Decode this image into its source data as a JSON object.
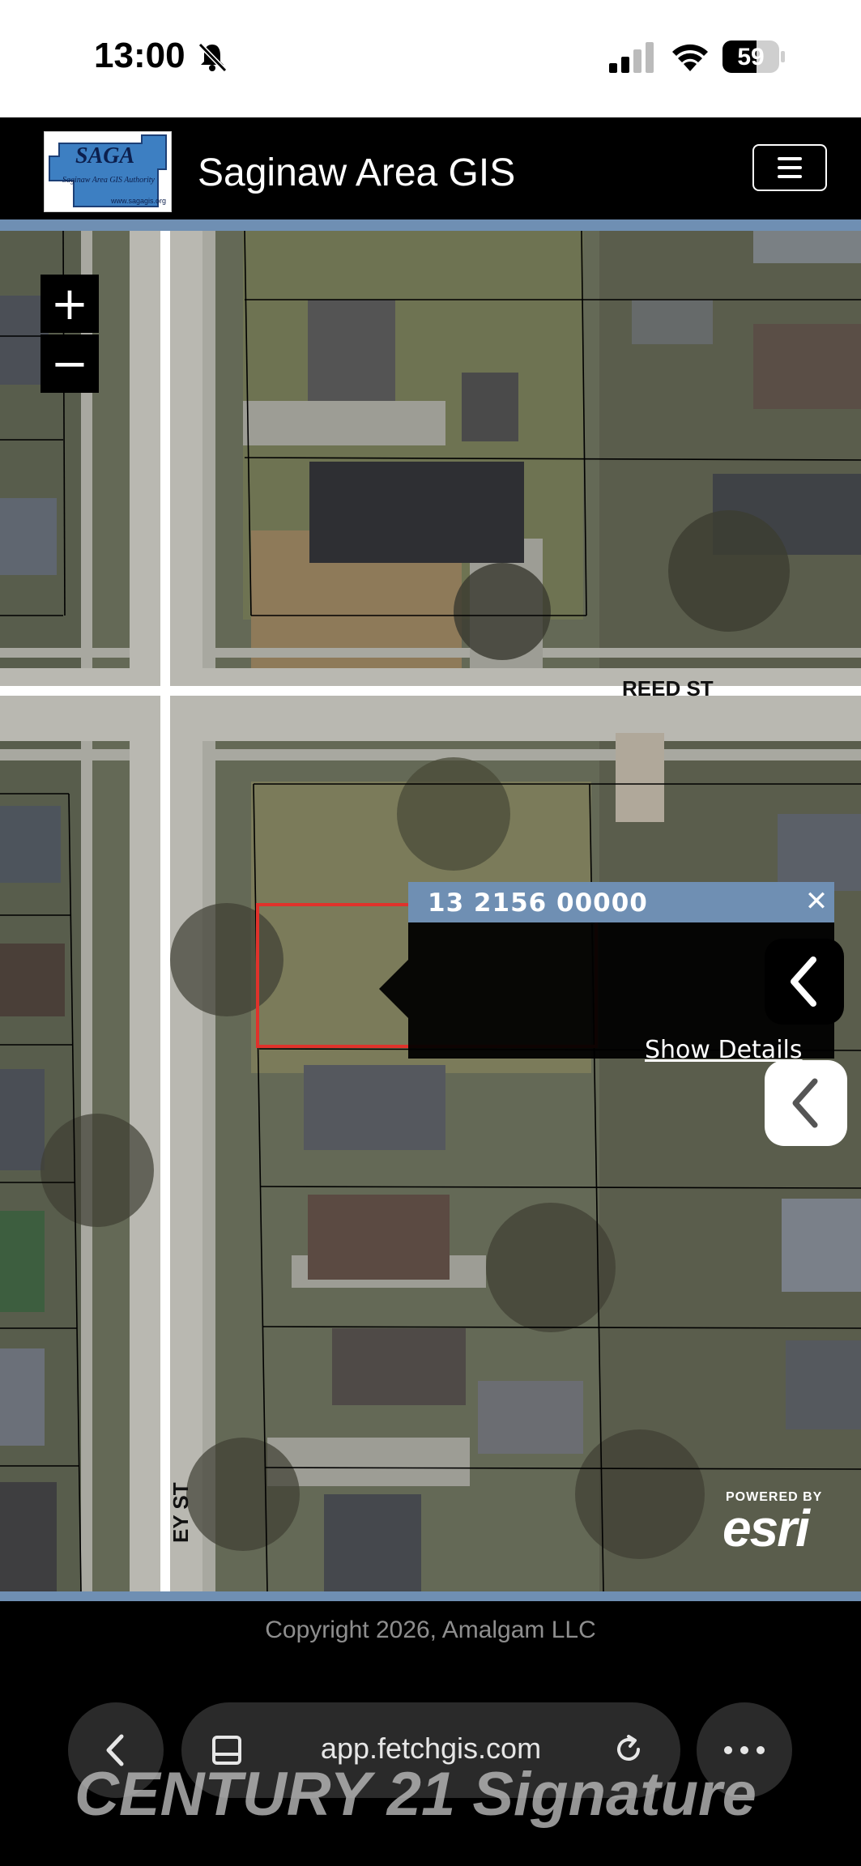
{
  "status_bar": {
    "time": "13:00",
    "battery": "59",
    "icons": [
      "bell-slash-icon",
      "cellular-signal-icon",
      "wifi-icon",
      "battery-icon"
    ]
  },
  "header": {
    "logo": {
      "title": "SAGA",
      "subtitle": "Saginaw Area GIS Authority",
      "url": "www.sagagis.org"
    },
    "title": "Saginaw Area GIS",
    "menu_icon": "hamburger-menu-icon"
  },
  "map": {
    "zoom_in_label": "+",
    "zoom_out_label": "−",
    "streets": {
      "horizontal": "REED ST",
      "vertical": "EY ST"
    },
    "popup": {
      "title": "13 2156 00000",
      "close_label": "✕",
      "link": "Show Details"
    },
    "attribution": {
      "powered_by": "POWERED BY",
      "brand": "esri"
    },
    "colors": {
      "selected_parcel": "#e0322b",
      "popup_header": "#6f8fb3"
    }
  },
  "footer": {
    "copyright": "Copyright 2026, Amalgam LLC"
  },
  "browser": {
    "url": "app.fetchgis.com",
    "icons": [
      "back-arrow-icon",
      "tabs-icon",
      "reload-icon",
      "more-icon"
    ]
  },
  "watermark": "CENTURY 21 Signature"
}
